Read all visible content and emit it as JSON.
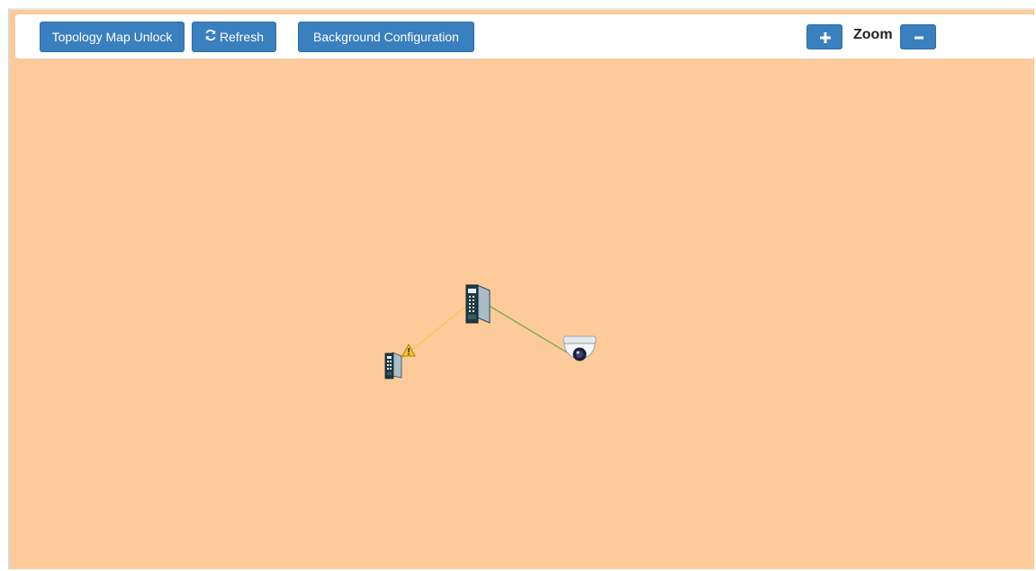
{
  "toolbar": {
    "unlock_label": "Topology Map Unlock",
    "refresh_label": "Refresh",
    "background_label": "Background Configuration",
    "zoom_label": "Zoom",
    "zoom_in_icon": "plus-icon",
    "zoom_out_icon": "minus-icon",
    "refresh_icon": "refresh-icon"
  },
  "map": {
    "background_color": "#fdca9a",
    "devices": [
      {
        "name": "switch-main",
        "type": "industrial-switch"
      },
      {
        "name": "switch-small",
        "type": "industrial-switch",
        "status": "warning"
      },
      {
        "name": "camera",
        "type": "dome-camera"
      }
    ],
    "links": [
      {
        "from": "switch-main",
        "to": "switch-small",
        "color": "#f2c84b"
      },
      {
        "from": "switch-main",
        "to": "camera",
        "color": "#7ab04e"
      }
    ]
  }
}
